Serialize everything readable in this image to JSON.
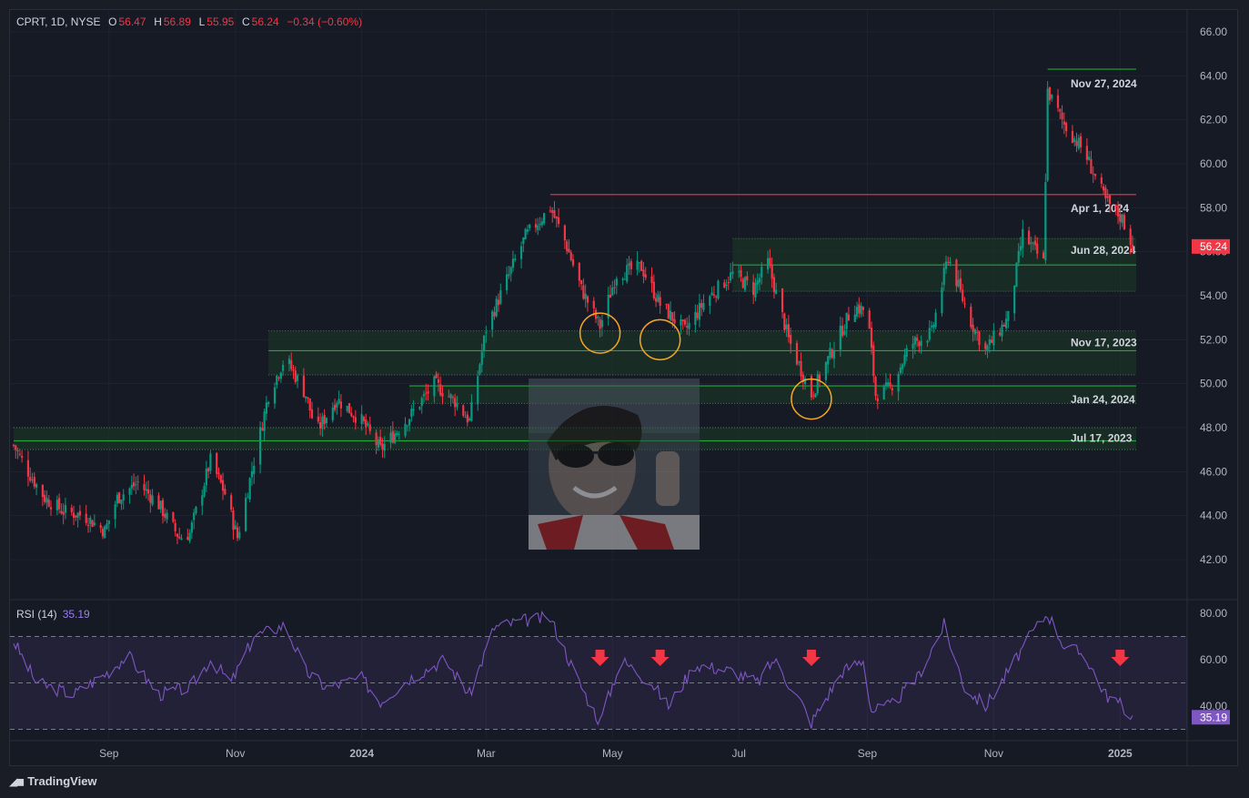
{
  "header": {
    "symbol": "CPRT, 1D, NYSE",
    "open_label": "O",
    "open": "56.47",
    "high_label": "H",
    "high": "56.89",
    "low_label": "L",
    "low": "55.95",
    "close_label": "C",
    "close": "56.24",
    "change": "−0.34 (−0.60%)"
  },
  "rsi": {
    "name": "RSI (14)",
    "value": "35.19"
  },
  "brand": {
    "name": "TradingView"
  },
  "colors": {
    "up": "#089981",
    "down": "#f23645",
    "rsi": "#7e57c2",
    "zone_fill": "#1b3a24",
    "level_green": "#22a53a",
    "level_red": "#f23645",
    "circle": "#f5a623"
  },
  "chart_data": {
    "type": "candlestick",
    "symbol": "CPRT",
    "interval": "1D",
    "exchange": "NYSE",
    "ylim": [
      41.0,
      66.5
    ],
    "y_ticks": [
      "66.00",
      "64.00",
      "62.00",
      "60.00",
      "58.00",
      "56.00",
      "54.00",
      "52.00",
      "50.00",
      "48.00",
      "46.00",
      "44.00",
      "42.00"
    ],
    "x_ticks": [
      "Sep",
      "Nov",
      "2024",
      "Mar",
      "May",
      "Jul",
      "Sep",
      "Nov",
      "2025"
    ],
    "last_price_label": "56.24",
    "close_path": [
      [
        "2023-07-17",
        47.2
      ],
      [
        "2023-07-24",
        46.0
      ],
      [
        "2023-08-01",
        44.8
      ],
      [
        "2023-08-10",
        44.2
      ],
      [
        "2023-08-20",
        44.0
      ],
      [
        "2023-08-30",
        43.3
      ],
      [
        "2023-09-05",
        44.8
      ],
      [
        "2023-09-15",
        45.5
      ],
      [
        "2023-09-25",
        44.5
      ],
      [
        "2023-10-05",
        43.0
      ],
      [
        "2023-10-10",
        43.2
      ],
      [
        "2023-10-20",
        46.5
      ],
      [
        "2023-10-27",
        45.0
      ],
      [
        "2023-11-02",
        43.0
      ],
      [
        "2023-11-10",
        46.5
      ],
      [
        "2023-11-17",
        49.5
      ],
      [
        "2023-11-25",
        51.2
      ],
      [
        "2023-12-05",
        49.5
      ],
      [
        "2023-12-10",
        47.8
      ],
      [
        "2023-12-20",
        49.3
      ],
      [
        "2024-01-01",
        48.3
      ],
      [
        "2024-01-10",
        47.0
      ],
      [
        "2024-01-24",
        48.5
      ],
      [
        "2024-02-05",
        50.0
      ],
      [
        "2024-02-15",
        49.2
      ],
      [
        "2024-02-22",
        48.3
      ],
      [
        "2024-03-01",
        52.5
      ],
      [
        "2024-03-10",
        54.5
      ],
      [
        "2024-03-20",
        56.7
      ],
      [
        "2024-04-01",
        58.0
      ],
      [
        "2024-04-08",
        56.5
      ],
      [
        "2024-04-16",
        54.3
      ],
      [
        "2024-04-25",
        52.6
      ],
      [
        "2024-05-03",
        55.0
      ],
      [
        "2024-05-15",
        55.3
      ],
      [
        "2024-05-24",
        53.6
      ],
      [
        "2024-06-05",
        52.4
      ],
      [
        "2024-06-15",
        53.8
      ],
      [
        "2024-06-28",
        55.0
      ],
      [
        "2024-07-08",
        54.3
      ],
      [
        "2024-07-15",
        55.5
      ],
      [
        "2024-07-25",
        52.0
      ],
      [
        "2024-08-05",
        49.5
      ],
      [
        "2024-08-15",
        51.5
      ],
      [
        "2024-08-25",
        53.5
      ],
      [
        "2024-09-01",
        53.3
      ],
      [
        "2024-09-05",
        49.5
      ],
      [
        "2024-09-12",
        49.8
      ],
      [
        "2024-09-22",
        51.8
      ],
      [
        "2024-10-02",
        52.3
      ],
      [
        "2024-10-10",
        55.8
      ],
      [
        "2024-10-20",
        53.0
      ],
      [
        "2024-10-28",
        51.5
      ],
      [
        "2024-11-08",
        53.0
      ],
      [
        "2024-11-15",
        56.8
      ],
      [
        "2024-11-25",
        55.5
      ],
      [
        "2024-11-27",
        63.3
      ],
      [
        "2024-12-05",
        61.8
      ],
      [
        "2024-12-15",
        60.5
      ],
      [
        "2024-12-25",
        58.3
      ],
      [
        "2025-01-02",
        57.5
      ],
      [
        "2025-01-07",
        56.24
      ]
    ],
    "levels": [
      {
        "label": "Nov 27, 2024",
        "price": 64.3,
        "color": "green",
        "from": "2024-11-27"
      },
      {
        "label": "Apr 1, 2024",
        "price": 58.6,
        "color": "red",
        "from": "2024-04-01"
      },
      {
        "label": "Jun 28, 2024",
        "price": 55.4,
        "color": "green",
        "from": "2024-06-28",
        "zone": [
          54.2,
          56.6
        ]
      },
      {
        "label": "Nov 17, 2023",
        "price": 51.5,
        "color": "green",
        "from": "2023-11-17",
        "zone": [
          50.4,
          52.4
        ]
      },
      {
        "label": "Jan 24, 2024",
        "price": 49.9,
        "color": "green",
        "from": "2024-01-24",
        "zone": [
          49.1,
          49.9
        ]
      },
      {
        "label": "Jul 17, 2023",
        "price": 47.4,
        "color": "green",
        "from": "2023-07-17",
        "zone": [
          47.0,
          48.0
        ]
      }
    ],
    "circles": [
      {
        "date": "2024-04-25",
        "price": 52.3
      },
      {
        "date": "2024-05-24",
        "price": 52.0
      },
      {
        "date": "2024-08-05",
        "price": 49.3
      }
    ],
    "rsi": {
      "period": 14,
      "ylim": [
        27,
        82
      ],
      "y_ticks": [
        "80.00",
        "60.00",
        "40.00"
      ],
      "bands": [
        30,
        50,
        70
      ],
      "current": 35.19,
      "path": [
        [
          "2023-07-17",
          68
        ],
        [
          "2023-07-28",
          50
        ],
        [
          "2023-08-15",
          45
        ],
        [
          "2023-09-01",
          55
        ],
        [
          "2023-09-10",
          62
        ],
        [
          "2023-09-25",
          45
        ],
        [
          "2023-10-10",
          48
        ],
        [
          "2023-10-20",
          60
        ],
        [
          "2023-10-30",
          50
        ],
        [
          "2023-11-10",
          70
        ],
        [
          "2023-11-25",
          75
        ],
        [
          "2023-12-05",
          55
        ],
        [
          "2023-12-15",
          48
        ],
        [
          "2024-01-01",
          52
        ],
        [
          "2024-01-10",
          42
        ],
        [
          "2024-01-24",
          52
        ],
        [
          "2024-02-10",
          60
        ],
        [
          "2024-02-22",
          45
        ],
        [
          "2024-03-05",
          74
        ],
        [
          "2024-03-20",
          77
        ],
        [
          "2024-04-01",
          78
        ],
        [
          "2024-04-15",
          50
        ],
        [
          "2024-04-25",
          33
        ],
        [
          "2024-05-05",
          60
        ],
        [
          "2024-05-20",
          50
        ],
        [
          "2024-05-28",
          40
        ],
        [
          "2024-06-10",
          58
        ],
        [
          "2024-06-28",
          55
        ],
        [
          "2024-07-10",
          50
        ],
        [
          "2024-07-18",
          60
        ],
        [
          "2024-08-01",
          40
        ],
        [
          "2024-08-05",
          33
        ],
        [
          "2024-08-20",
          55
        ],
        [
          "2024-08-30",
          60
        ],
        [
          "2024-09-03",
          38
        ],
        [
          "2024-09-12",
          40
        ],
        [
          "2024-09-25",
          52
        ],
        [
          "2024-10-08",
          75
        ],
        [
          "2024-10-18",
          48
        ],
        [
          "2024-10-28",
          40
        ],
        [
          "2024-11-08",
          55
        ],
        [
          "2024-11-15",
          65
        ],
        [
          "2024-11-20",
          72
        ],
        [
          "2024-11-27",
          80
        ],
        [
          "2024-12-05",
          66
        ],
        [
          "2024-12-15",
          62
        ],
        [
          "2024-12-25",
          45
        ],
        [
          "2025-01-02",
          40
        ],
        [
          "2025-01-07",
          35.19
        ]
      ]
    },
    "rsi_arrows": [
      "2024-04-25",
      "2024-05-24",
      "2024-08-05",
      "2025-01-01"
    ]
  }
}
